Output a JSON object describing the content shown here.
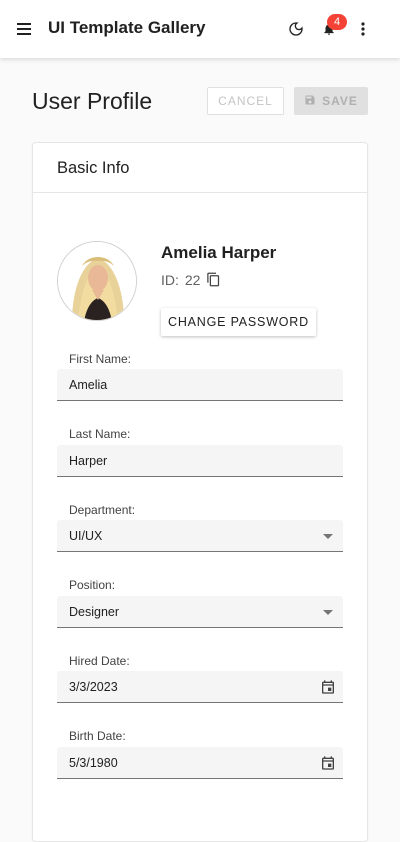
{
  "app": {
    "title": "UI Template Gallery",
    "notification_count": "4"
  },
  "page": {
    "title": "User Profile",
    "cancel_label": "CANCEL",
    "save_label": "SAVE"
  },
  "card": {
    "title": "Basic Info"
  },
  "user": {
    "name": "Amelia Harper",
    "id_label": "ID:",
    "id_value": "22",
    "change_password_label": "CHANGE PASSWORD"
  },
  "form": {
    "first_name": {
      "label": "First Name:",
      "value": "Amelia"
    },
    "last_name": {
      "label": "Last Name:",
      "value": "Harper"
    },
    "department": {
      "label": "Department:",
      "value": "UI/UX"
    },
    "position": {
      "label": "Position:",
      "value": "Designer"
    },
    "hired_date": {
      "label": "Hired Date:",
      "value": "3/3/2023"
    },
    "birth_date": {
      "label": "Birth Date:",
      "value": "5/3/1980"
    }
  },
  "icons": {
    "menu": "menu-icon",
    "theme": "moon-icon",
    "notifications": "bell-icon",
    "more": "more-vert-icon",
    "save": "save-icon",
    "copy": "copy-icon",
    "dropdown": "arrow-drop-down-icon",
    "calendar": "calendar-icon"
  },
  "colors": {
    "badge": "#f44336",
    "disabled_button": "#e0e0e0"
  }
}
